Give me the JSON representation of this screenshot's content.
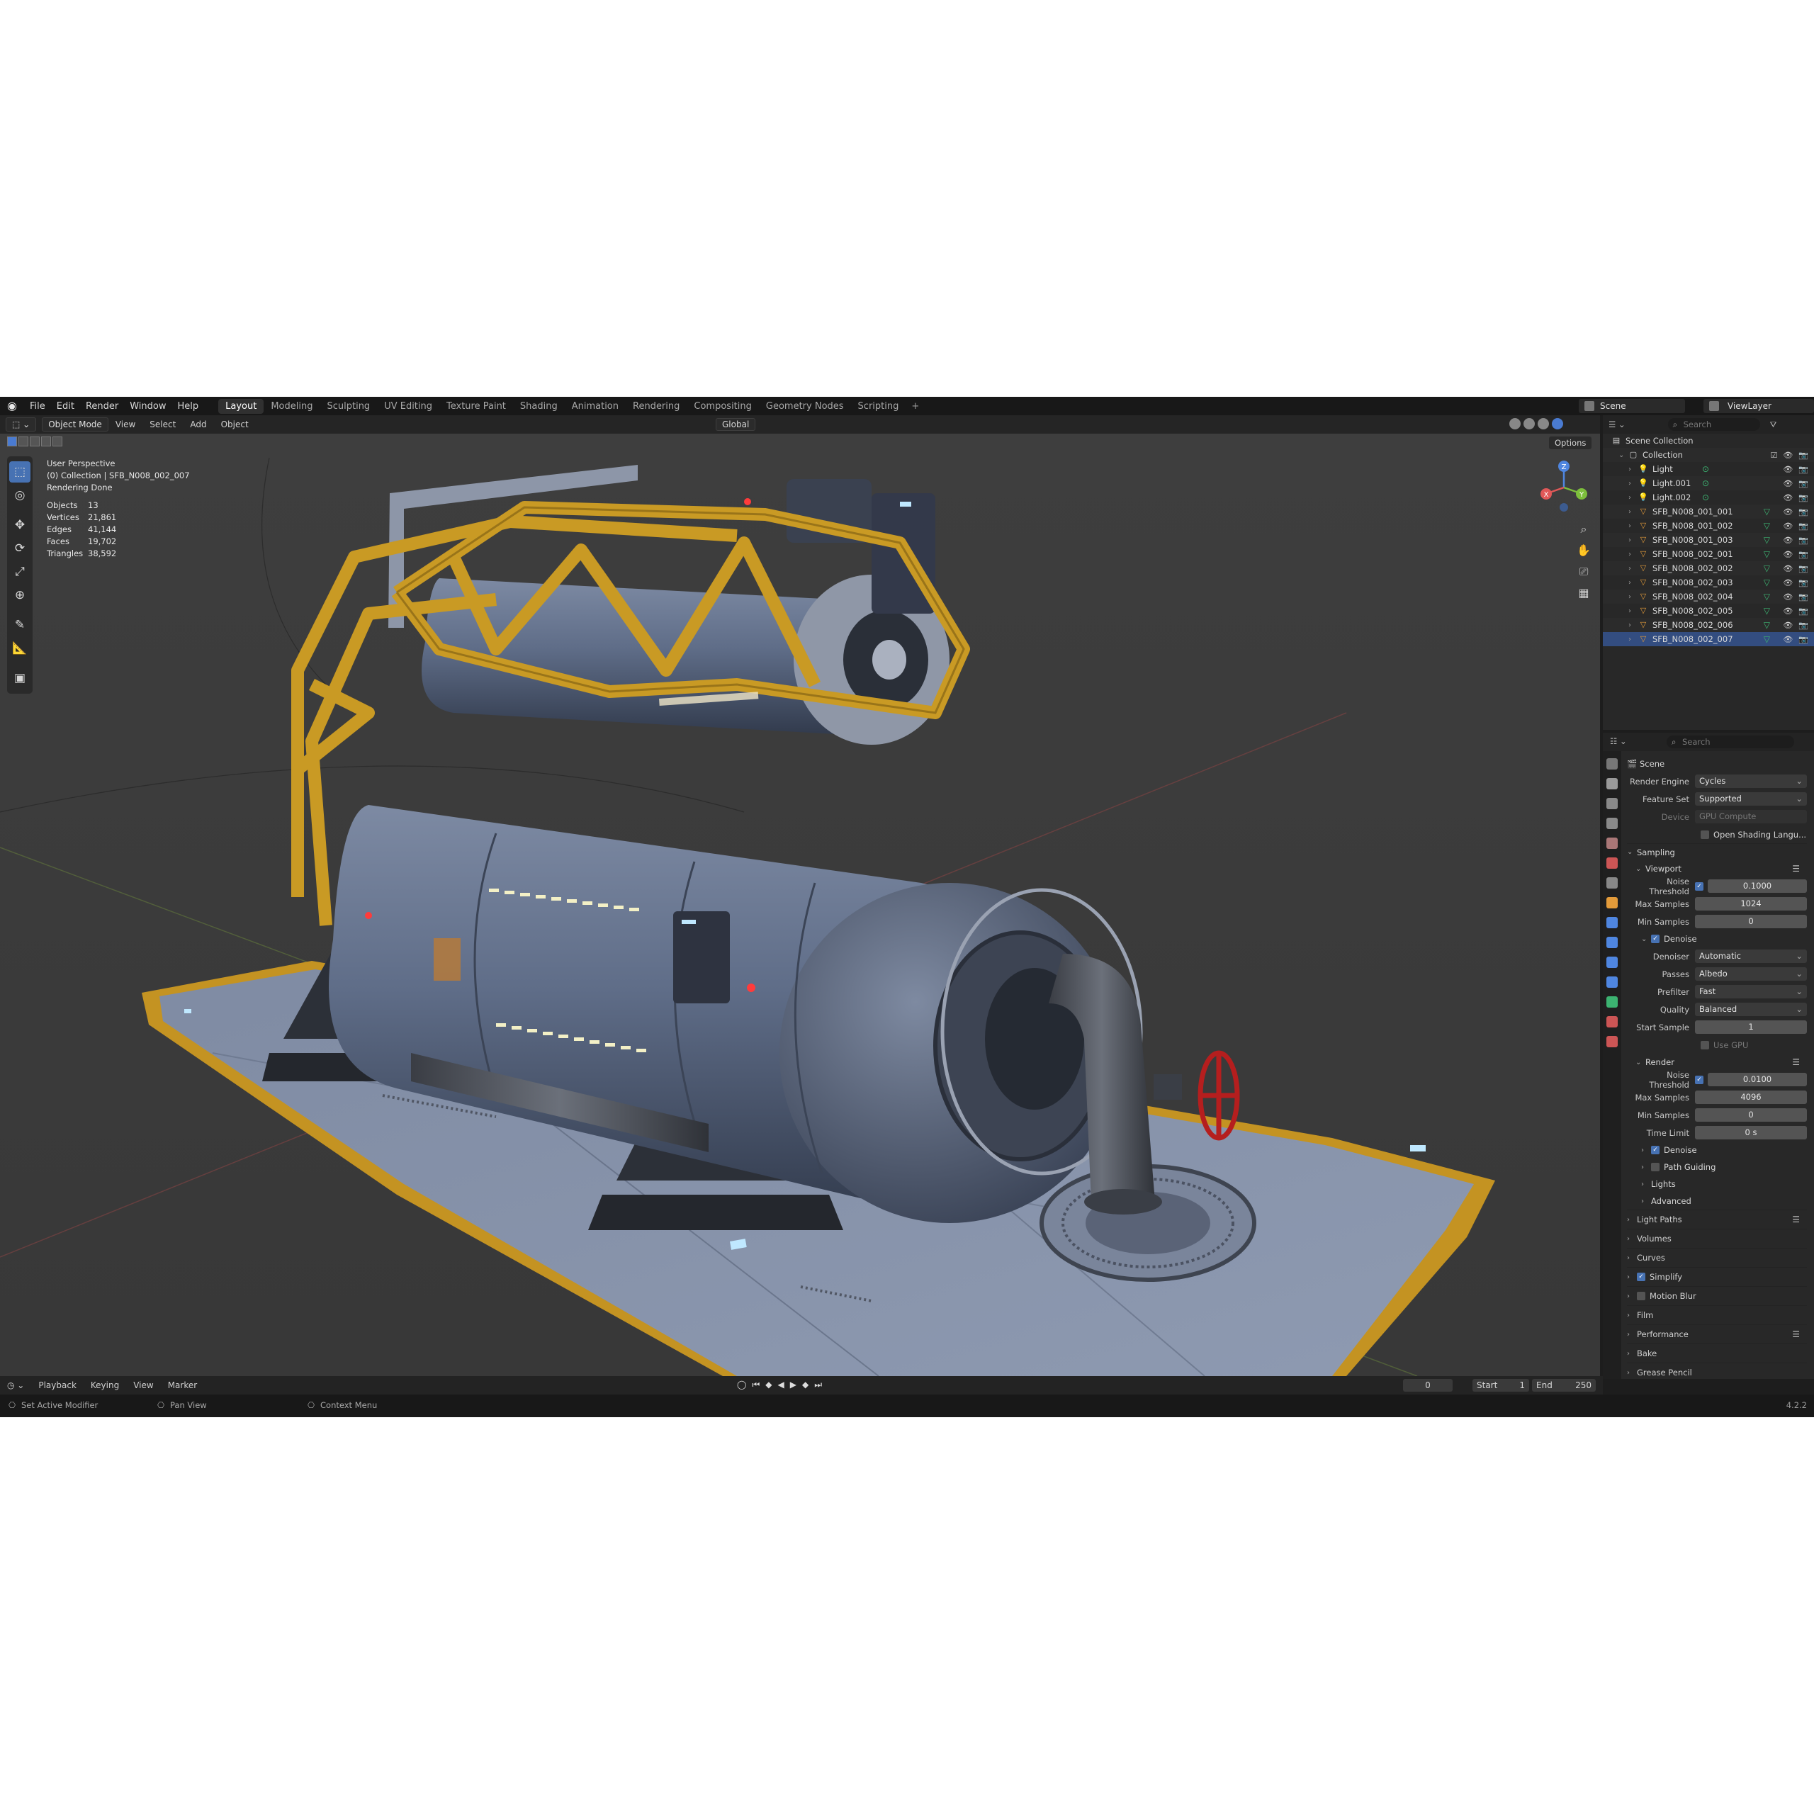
{
  "menus": [
    "File",
    "Edit",
    "Render",
    "Window",
    "Help"
  ],
  "workspaces": [
    {
      "label": "Layout",
      "active": true
    },
    {
      "label": "Modeling"
    },
    {
      "label": "Sculpting"
    },
    {
      "label": "UV Editing"
    },
    {
      "label": "Texture Paint"
    },
    {
      "label": "Shading"
    },
    {
      "label": "Animation"
    },
    {
      "label": "Rendering"
    },
    {
      "label": "Compositing"
    },
    {
      "label": "Geometry Nodes"
    },
    {
      "label": "Scripting"
    }
  ],
  "scene_name": "Scene",
  "view_layer": "ViewLayer",
  "viewport": {
    "mode": "Object Mode",
    "menus": [
      "View",
      "Select",
      "Add",
      "Object"
    ],
    "orientation": "Global",
    "options_label": "Options",
    "perspective": "User Perspective",
    "collection_line": "(0) Collection | SFB_N008_002_007",
    "render_status": "Rendering Done",
    "stats": [
      {
        "label": "Objects",
        "value": "13"
      },
      {
        "label": "Vertices",
        "value": "21,861"
      },
      {
        "label": "Edges",
        "value": "41,144"
      },
      {
        "label": "Faces",
        "value": "19,702"
      },
      {
        "label": "Triangles",
        "value": "38,592"
      }
    ],
    "gizmo_axes": {
      "z": "Z",
      "y": "Y",
      "x": "X"
    }
  },
  "outliner": {
    "search_placeholder": "Search",
    "scene_collection": "Scene Collection",
    "collection": "Collection",
    "items": [
      {
        "name": "Light",
        "type": "light"
      },
      {
        "name": "Light.001",
        "type": "light"
      },
      {
        "name": "Light.002",
        "type": "light"
      },
      {
        "name": "SFB_N008_001_001",
        "type": "mesh"
      },
      {
        "name": "SFB_N008_001_002",
        "type": "mesh"
      },
      {
        "name": "SFB_N008_001_003",
        "type": "mesh"
      },
      {
        "name": "SFB_N008_002_001",
        "type": "mesh"
      },
      {
        "name": "SFB_N008_002_002",
        "type": "mesh"
      },
      {
        "name": "SFB_N008_002_003",
        "type": "mesh"
      },
      {
        "name": "SFB_N008_002_004",
        "type": "mesh"
      },
      {
        "name": "SFB_N008_002_005",
        "type": "mesh"
      },
      {
        "name": "SFB_N008_002_006",
        "type": "mesh"
      },
      {
        "name": "SFB_N008_002_007",
        "type": "mesh",
        "selected": true
      }
    ]
  },
  "properties": {
    "search_placeholder": "Search",
    "context": "Scene",
    "render_engine_label": "Render Engine",
    "render_engine": "Cycles",
    "feature_set_label": "Feature Set",
    "feature_set": "Supported",
    "device_label": "Device",
    "device": "GPU Compute",
    "osl_label": "Open Shading Langu...",
    "sampling": "Sampling",
    "viewport_panel": "Viewport",
    "vp_noise_threshold_label": "Noise Threshold",
    "vp_noise_threshold": "0.1000",
    "vp_max_samples_label": "Max Samples",
    "vp_max_samples": "1024",
    "vp_min_samples_label": "Min Samples",
    "vp_min_samples": "0",
    "vp_denoise": "Denoise",
    "denoiser_label": "Denoiser",
    "denoiser": "Automatic",
    "passes_label": "Passes",
    "passes": "Albedo",
    "prefilter_label": "Prefilter",
    "prefilter": "Fast",
    "quality_label": "Quality",
    "quality": "Balanced",
    "start_sample_label": "Start Sample",
    "start_sample": "1",
    "use_gpu": "Use GPU",
    "render_panel": "Render",
    "r_noise_threshold_label": "Noise Threshold",
    "r_noise_threshold": "0.0100",
    "r_max_samples_label": "Max Samples",
    "r_max_samples": "4096",
    "r_min_samples_label": "Min Samples",
    "r_min_samples": "0",
    "r_time_limit_label": "Time Limit",
    "r_time_limit": "0 s",
    "r_denoise": "Denoise",
    "path_guiding": "Path Guiding",
    "lights": "Lights",
    "advanced": "Advanced",
    "collapsed": [
      "Light Paths",
      "Volumes",
      "Curves",
      "Simplify",
      "Motion Blur",
      "Film",
      "Performance",
      "Bake",
      "Grease Pencil"
    ]
  },
  "timeline": {
    "menus": [
      "Playback",
      "Keying",
      "View",
      "Marker"
    ],
    "current_frame": "0",
    "start_label": "Start",
    "start": "1",
    "end_label": "End",
    "end": "250"
  },
  "status": {
    "left": "Set Active Modifier",
    "middle": "Pan View",
    "right": "Context Menu",
    "version": "4.2.2"
  },
  "colors": {
    "accent": "#4772b3",
    "frame_yellow": "#c99a24",
    "tank_blue": "#5f6f8a",
    "viewport_bg": "#3c3c3c"
  }
}
